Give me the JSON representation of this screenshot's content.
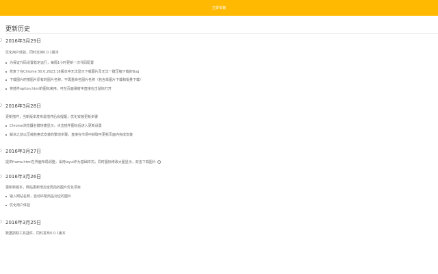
{
  "header": {
    "install_button": "立即安装"
  },
  "page_title": "更新历史",
  "entries": [
    {
      "date": "2016年3月29日",
      "summary": "优化用户体验，同时支持0.0.1版本",
      "items": [
        "为保证代码设置稳定运行，每隔1小时更新一次代码配置",
        "修复了在Chrome 50.0.2623.18版本中无法显示下载图片及无法一键压缩下载的Bug",
        "下载图片时按图片原有的图片名称，不再重命名图片名称（包含单图片下载和批量下载）",
        "将插件option.html的图标来用，可在页面弹窗中直接右击鼠标打开"
      ]
    },
    {
      "date": "2016年3月28日",
      "summary": "更新插件，当新版本发布是插件后会提醒；优化安装更新步骤",
      "items": [
        "Chrome浏览器右键快捷显示，点击插件图标后进入更新设置",
        "解决之前以压缩包格式安装的繁琐步骤，直接在市场中获取可更新页面内完成安装"
      ]
    },
    {
      "date": "2016年3月27日",
      "summary": "提供frame.html在界面布局调整，采用layui作为基础样式；同时图标修改大图显示，双击下载图片",
      "items": []
    },
    {
      "date": "2016年3月26日",
      "summary": "更新新版本，网站更新增加全局前的图片优化项目",
      "items": [
        "输入网站名称，自动匹配商品对应的图片",
        "优化用户体验"
      ]
    },
    {
      "date": "2016年3月25日",
      "summary": "数据抓取工具插件，同时发布0.0.1版本",
      "items": []
    }
  ]
}
